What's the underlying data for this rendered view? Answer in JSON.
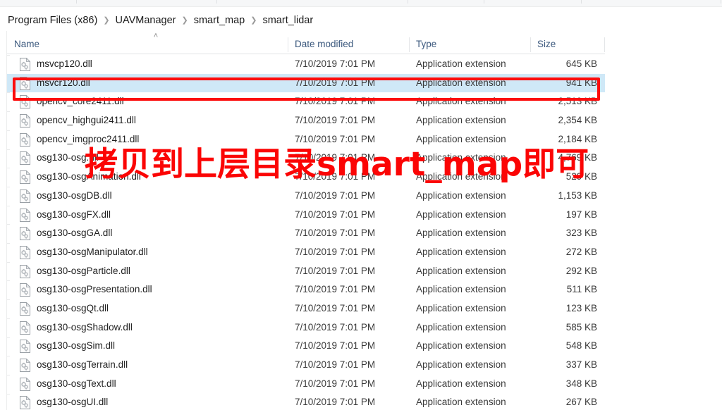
{
  "window": {
    "app": "file-explorer"
  },
  "breadcrumb": {
    "separator": "❯",
    "items": [
      {
        "label": "Program Files (x86)"
      },
      {
        "label": "UAVManager"
      },
      {
        "label": "smart_map"
      },
      {
        "label": "smart_lidar"
      }
    ]
  },
  "columns": [
    {
      "key": "name",
      "label": "Name",
      "sorted": "ascending",
      "sort_glyph": "˄"
    },
    {
      "key": "date",
      "label": "Date modified"
    },
    {
      "key": "type",
      "label": "Type"
    },
    {
      "key": "size",
      "label": "Size"
    }
  ],
  "files": [
    {
      "name": "msvcp120.dll",
      "date": "7/10/2019 7:01 PM",
      "type": "Application extension",
      "size": "645 KB",
      "selected": false,
      "icon": "dll-file-icon"
    },
    {
      "name": "msvcr120.dll",
      "date": "7/10/2019 7:01 PM",
      "type": "Application extension",
      "size": "941 KB",
      "selected": true,
      "icon": "dll-file-icon"
    },
    {
      "name": "opencv_core2411.dll",
      "date": "7/10/2019 7:01 PM",
      "type": "Application extension",
      "size": "2,513 KB",
      "selected": false,
      "icon": "dll-file-icon"
    },
    {
      "name": "opencv_highgui2411.dll",
      "date": "7/10/2019 7:01 PM",
      "type": "Application extension",
      "size": "2,354 KB",
      "selected": false,
      "icon": "dll-file-icon"
    },
    {
      "name": "opencv_imgproc2411.dll",
      "date": "7/10/2019 7:01 PM",
      "type": "Application extension",
      "size": "2,184 KB",
      "selected": false,
      "icon": "dll-file-icon"
    },
    {
      "name": "osg130-osg.dll",
      "date": "7/10/2019 7:01 PM",
      "type": "Application extension",
      "size": "4,769 KB",
      "selected": false,
      "icon": "dll-file-icon"
    },
    {
      "name": "osg130-osgAnimation.dll",
      "date": "7/10/2019 7:01 PM",
      "type": "Application extension",
      "size": "529 KB",
      "selected": false,
      "icon": "dll-file-icon"
    },
    {
      "name": "osg130-osgDB.dll",
      "date": "7/10/2019 7:01 PM",
      "type": "Application extension",
      "size": "1,153 KB",
      "selected": false,
      "icon": "dll-file-icon"
    },
    {
      "name": "osg130-osgFX.dll",
      "date": "7/10/2019 7:01 PM",
      "type": "Application extension",
      "size": "197 KB",
      "selected": false,
      "icon": "dll-file-icon"
    },
    {
      "name": "osg130-osgGA.dll",
      "date": "7/10/2019 7:01 PM",
      "type": "Application extension",
      "size": "323 KB",
      "selected": false,
      "icon": "dll-file-icon"
    },
    {
      "name": "osg130-osgManipulator.dll",
      "date": "7/10/2019 7:01 PM",
      "type": "Application extension",
      "size": "272 KB",
      "selected": false,
      "icon": "dll-file-icon"
    },
    {
      "name": "osg130-osgParticle.dll",
      "date": "7/10/2019 7:01 PM",
      "type": "Application extension",
      "size": "292 KB",
      "selected": false,
      "icon": "dll-file-icon"
    },
    {
      "name": "osg130-osgPresentation.dll",
      "date": "7/10/2019 7:01 PM",
      "type": "Application extension",
      "size": "511 KB",
      "selected": false,
      "icon": "dll-file-icon"
    },
    {
      "name": "osg130-osgQt.dll",
      "date": "7/10/2019 7:01 PM",
      "type": "Application extension",
      "size": "123 KB",
      "selected": false,
      "icon": "dll-file-icon"
    },
    {
      "name": "osg130-osgShadow.dll",
      "date": "7/10/2019 7:01 PM",
      "type": "Application extension",
      "size": "585 KB",
      "selected": false,
      "icon": "dll-file-icon"
    },
    {
      "name": "osg130-osgSim.dll",
      "date": "7/10/2019 7:01 PM",
      "type": "Application extension",
      "size": "548 KB",
      "selected": false,
      "icon": "dll-file-icon"
    },
    {
      "name": "osg130-osgTerrain.dll",
      "date": "7/10/2019 7:01 PM",
      "type": "Application extension",
      "size": "337 KB",
      "selected": false,
      "icon": "dll-file-icon"
    },
    {
      "name": "osg130-osgText.dll",
      "date": "7/10/2019 7:01 PM",
      "type": "Application extension",
      "size": "348 KB",
      "selected": false,
      "icon": "dll-file-icon"
    },
    {
      "name": "osg130-osgUI.dll",
      "date": "7/10/2019 7:01 PM",
      "type": "Application extension",
      "size": "267 KB",
      "selected": false,
      "icon": "dll-file-icon"
    }
  ],
  "annotations": {
    "callout_text": "拷贝到上层目录smart_map即可",
    "highlight_color": "#fc0d0d",
    "selection_color": "#cfe8f7"
  }
}
